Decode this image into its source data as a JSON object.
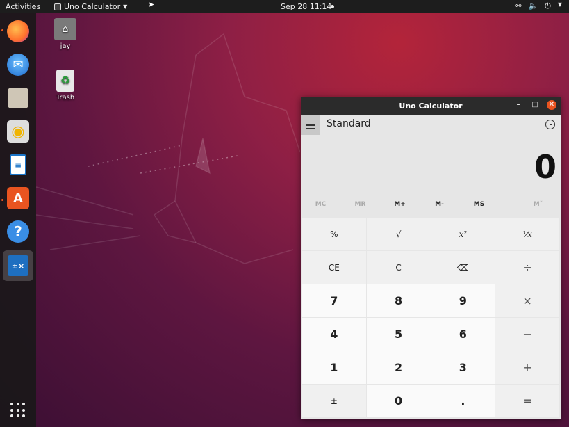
{
  "topbar": {
    "activities": "Activities",
    "app_name": "Uno Calculator",
    "clock": "Sep 28  11:14"
  },
  "dock": {
    "items": [
      "firefox-icon",
      "thunderbird-icon",
      "files-icon",
      "rhythmbox-icon",
      "writer-icon",
      "software-icon",
      "help-icon",
      "calculator-icon"
    ]
  },
  "desktop": {
    "home_label": "jay",
    "trash_label": "Trash"
  },
  "calc": {
    "title": "Uno Calculator",
    "mode": "Standard",
    "display": "0",
    "memory": [
      "MC",
      "MR",
      "M+",
      "M-",
      "MS",
      "M˅"
    ],
    "keys": [
      "%",
      "√",
      "x²",
      "¹⁄x",
      "CE",
      "C",
      "⌫",
      "÷",
      "7",
      "8",
      "9",
      "×",
      "4",
      "5",
      "6",
      "−",
      "1",
      "2",
      "3",
      "+",
      "±",
      "0",
      ".",
      "="
    ]
  },
  "colors": {
    "accent": "#e95420",
    "topbar": "#1d1d1d"
  }
}
